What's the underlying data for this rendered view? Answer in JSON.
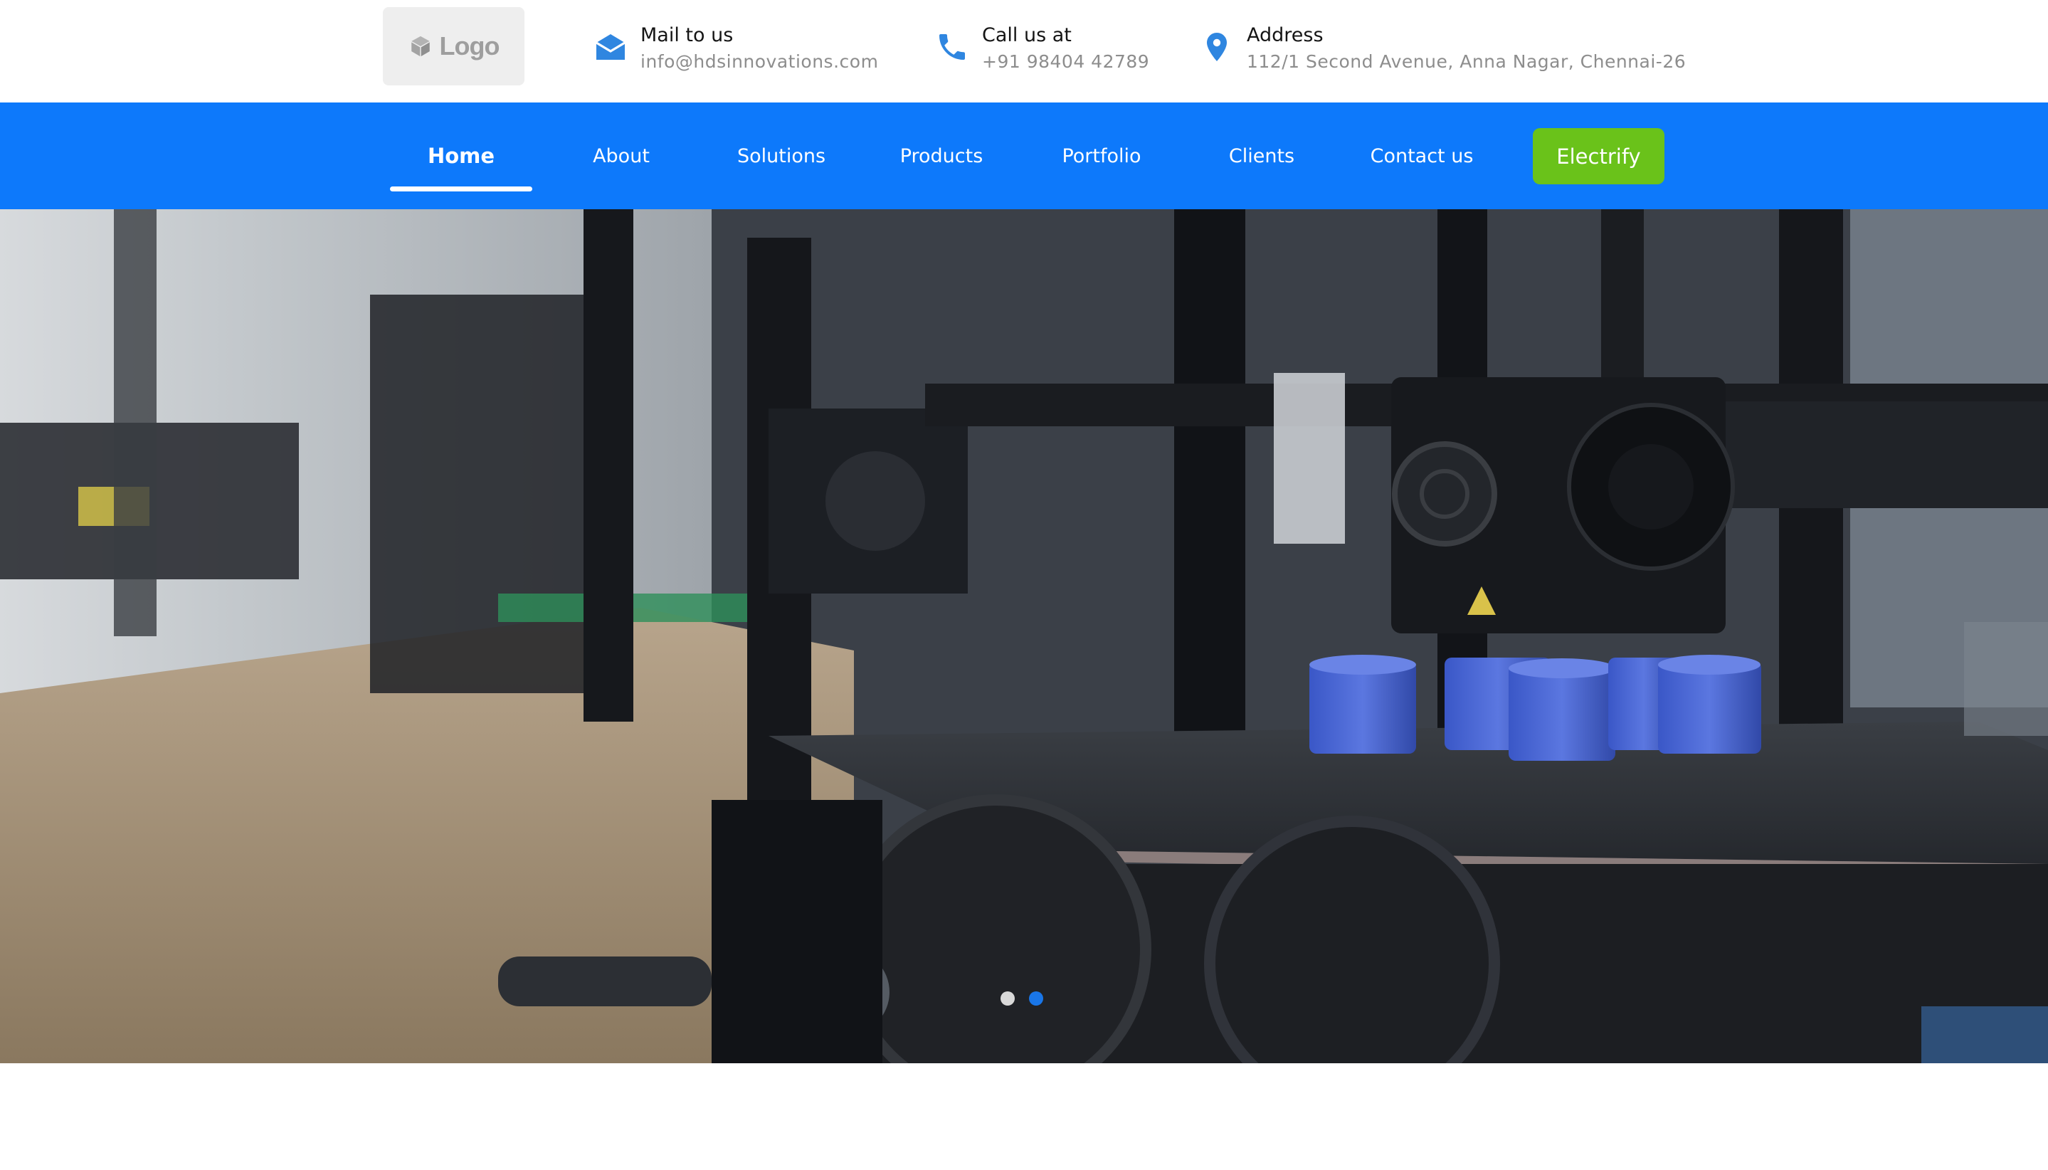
{
  "header": {
    "logo": {
      "text": "Logo",
      "icon": "cube-icon"
    },
    "contacts": [
      {
        "label": "Mail to us",
        "value": "info@hdsinnovations.com",
        "icon": "mail-icon"
      },
      {
        "label": "Call us at",
        "value": "+91 98404 42789",
        "icon": "phone-icon"
      },
      {
        "label": "Address",
        "value": "112/1 Second Avenue, Anna Nagar, Chennai-26",
        "icon": "location-pin-icon"
      }
    ]
  },
  "nav": {
    "items": [
      {
        "label": "Home",
        "active": true
      },
      {
        "label": "About"
      },
      {
        "label": "Solutions"
      },
      {
        "label": "Products"
      },
      {
        "label": "Portfolio"
      },
      {
        "label": "Clients"
      },
      {
        "label": "Contact us"
      }
    ],
    "cta_label": "Electrify"
  },
  "hero": {
    "image": "3d-printer-workshop-photo",
    "slides_count": 2,
    "active_slide": 2
  },
  "colors": {
    "nav_bg": "#0d79fb",
    "cta_bg": "#6ac21a",
    "icon_blue": "#2f86e0",
    "active_dot": "#1976e8"
  }
}
